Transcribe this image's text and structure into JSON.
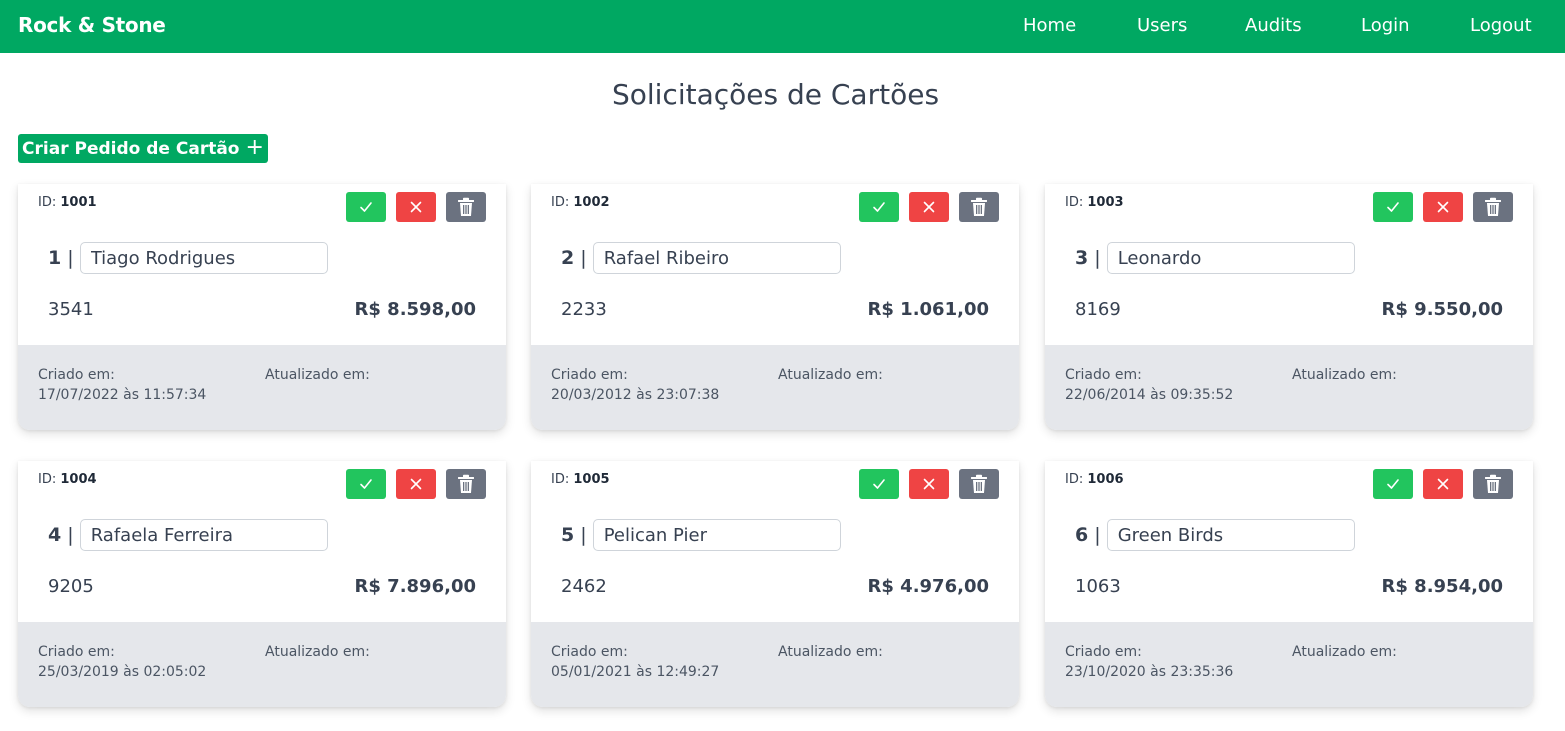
{
  "navbar": {
    "brand": "Rock & Stone",
    "links": [
      {
        "label": "Home"
      },
      {
        "label": "Users"
      },
      {
        "label": "Audits"
      },
      {
        "label": "Login"
      },
      {
        "label": "Logout"
      }
    ]
  },
  "page": {
    "title": "Solicitações de Cartões",
    "create_button_label": "Criar Pedido de Cartão",
    "create_button_icon": "plus-icon"
  },
  "labels": {
    "id_prefix": "ID:",
    "created_label": "Criado em:",
    "updated_label": "Atualizado em:"
  },
  "colors": {
    "brand_green": "#00a862",
    "approve": "#22c55e",
    "reject": "#ef4444",
    "delete": "#6b7280",
    "footer_bg": "#e5e7eb"
  },
  "cards": [
    {
      "id": "1001",
      "number": "1",
      "name": "Tiago Rodrigues",
      "code": "3541",
      "price": "R$ 8.598,00",
      "created": "17/07/2022 às 11:57:34",
      "updated": ""
    },
    {
      "id": "1002",
      "number": "2",
      "name": "Rafael Ribeiro",
      "code": "2233",
      "price": "R$ 1.061,00",
      "created": "20/03/2012 às 23:07:38",
      "updated": ""
    },
    {
      "id": "1003",
      "number": "3",
      "name": "Leonardo",
      "code": "8169",
      "price": "R$ 9.550,00",
      "created": "22/06/2014 às 09:35:52",
      "updated": ""
    },
    {
      "id": "1004",
      "number": "4",
      "name": "Rafaela Ferreira",
      "code": "9205",
      "price": "R$ 7.896,00",
      "created": "25/03/2019 às 02:05:02",
      "updated": ""
    },
    {
      "id": "1005",
      "number": "5",
      "name": "Pelican Pier",
      "code": "2462",
      "price": "R$ 4.976,00",
      "created": "05/01/2021 às 12:49:27",
      "updated": ""
    },
    {
      "id": "1006",
      "number": "6",
      "name": "Green Birds",
      "code": "1063",
      "price": "R$ 8.954,00",
      "created": "23/10/2020 às 23:35:36",
      "updated": ""
    }
  ],
  "action_icons": [
    "check-icon",
    "x-icon",
    "trash-icon"
  ]
}
